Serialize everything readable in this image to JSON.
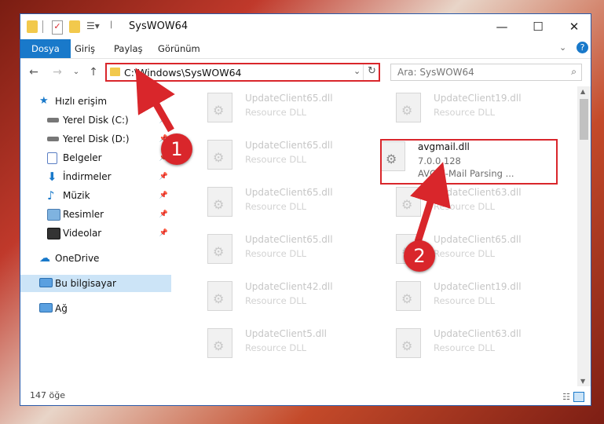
{
  "window": {
    "title": "SysWOW64",
    "controls": {
      "minimize": "—",
      "maximize": "☐",
      "close": "✕"
    }
  },
  "ribbon": {
    "tabs": [
      {
        "label": "Dosya",
        "active": true
      },
      {
        "label": "Giriş"
      },
      {
        "label": "Paylaş"
      },
      {
        "label": "Görünüm"
      }
    ]
  },
  "address": {
    "path": "C:\\Windows\\SysWOW64"
  },
  "search": {
    "placeholder": "Ara: SysWOW64"
  },
  "sidebar": {
    "items": [
      {
        "label": "Hızlı erişim",
        "icon": "star-icon"
      },
      {
        "label": "Yerel Disk (C:)",
        "icon": "drive-icon"
      },
      {
        "label": "Yerel Disk (D:)",
        "icon": "drive-icon"
      },
      {
        "label": "Belgeler",
        "icon": "documents-icon"
      },
      {
        "label": "İndirmeler",
        "icon": "download-icon"
      },
      {
        "label": "Müzik",
        "icon": "music-icon"
      },
      {
        "label": "Resimler",
        "icon": "pictures-icon"
      },
      {
        "label": "Videolar",
        "icon": "videos-icon"
      },
      {
        "label": "OneDrive",
        "icon": "cloud-icon"
      },
      {
        "label": "Bu bilgisayar",
        "icon": "computer-icon"
      },
      {
        "label": "Ağ",
        "icon": "network-icon"
      }
    ]
  },
  "files": {
    "left": [
      {
        "name": "UpdateClient65.dll",
        "desc": "Resource DLL"
      },
      {
        "name": "UpdateClient65.dll",
        "desc": "Resource DLL"
      },
      {
        "name": "UpdateClient65.dll",
        "desc": "Resource DLL"
      },
      {
        "name": "UpdateClient65.dll",
        "desc": "Resource DLL"
      },
      {
        "name": "UpdateClient42.dll",
        "desc": "Resource DLL"
      },
      {
        "name": "UpdateClient5.dll",
        "desc": "Resource DLL"
      }
    ],
    "right": [
      {
        "name": "UpdateClient19.dll",
        "desc": "Resource DLL"
      },
      {
        "name": "avgmail.dll",
        "desc": "7.0.0.128",
        "desc2": "AVG E-Mail Parsing ..."
      },
      {
        "name": "UpdateClient63.dll",
        "desc": "Resource DLL"
      },
      {
        "name": "UpdateClient65.dll",
        "desc": "Resource DLL"
      },
      {
        "name": "UpdateClient19.dll",
        "desc": "Resource DLL"
      },
      {
        "name": "UpdateClient63.dll",
        "desc": "Resource DLL"
      }
    ]
  },
  "status": {
    "count": "147 öğe"
  },
  "annotations": {
    "step1": "1",
    "step2": "2"
  },
  "colors": {
    "highlight": "#d9262b",
    "accent": "#1979ca"
  }
}
